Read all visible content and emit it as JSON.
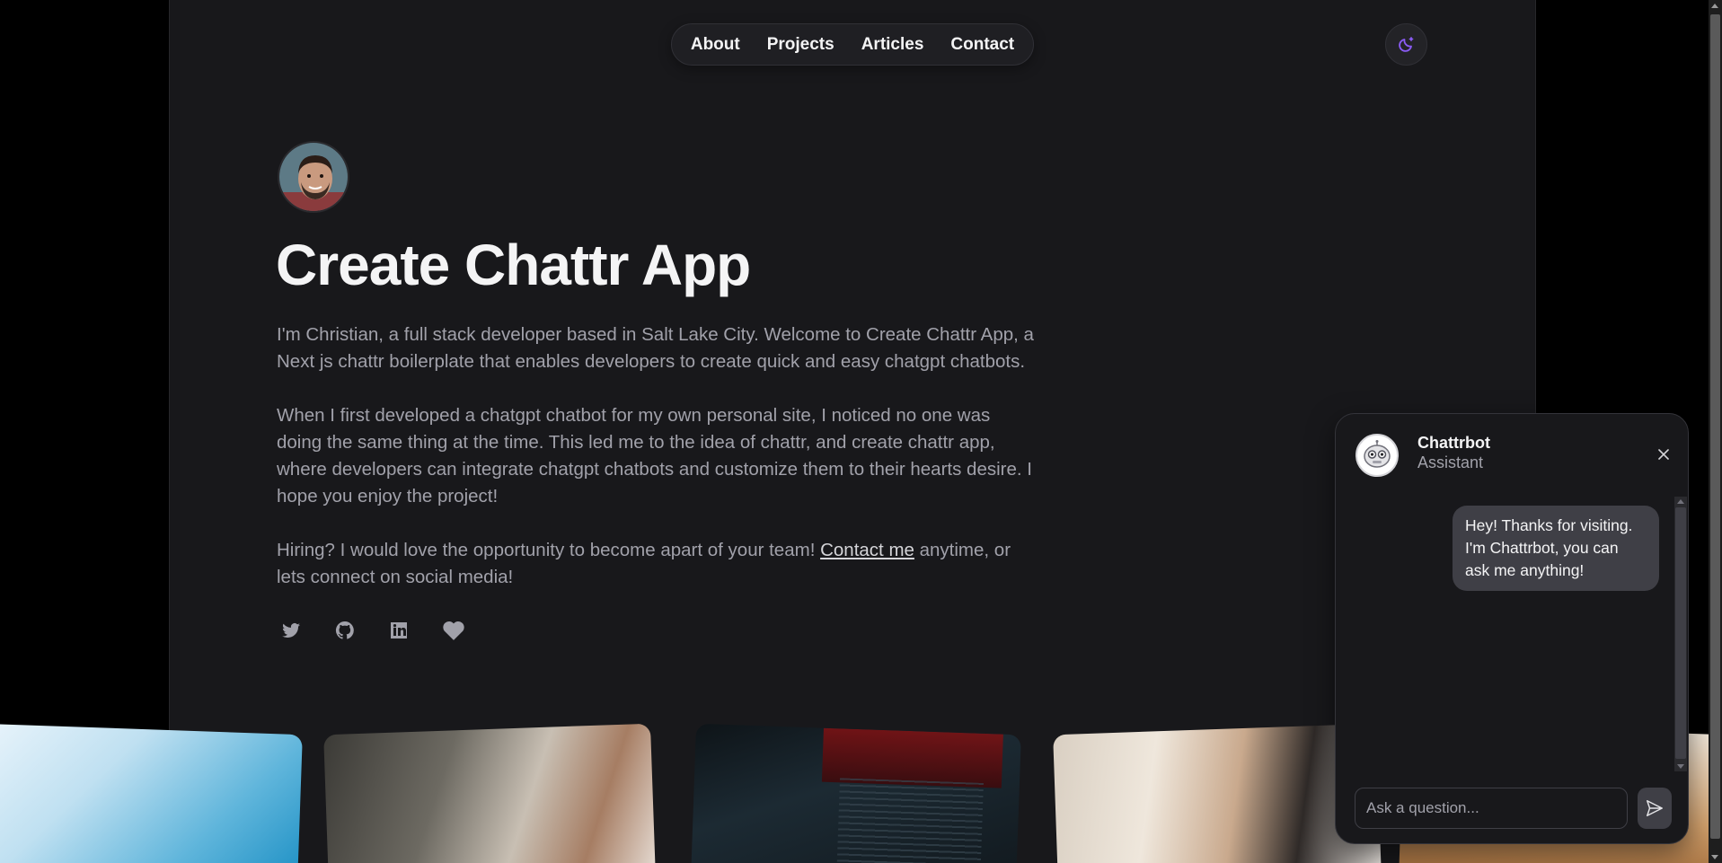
{
  "nav": {
    "links": [
      "About",
      "Projects",
      "Articles",
      "Contact"
    ]
  },
  "theme_toggle": {
    "icon": "moon-sparkle-icon",
    "accent": "#8b5cf6"
  },
  "hero": {
    "title": "Create Chattr App",
    "p1": "I'm Christian, a full stack developer based in Salt Lake City. Welcome to Create Chattr App, a Next js chattr boilerplate that enables developers to create quick and easy chatgpt chatbots.",
    "p2": "When I first developed a chatgpt chatbot for my own personal site, I noticed no one was doing the same thing at the time. This led me to the idea of chattr, and create chattr app, where developers can integrate chatgpt chatbots and customize them to their hearts desire. I hope you enjoy the project!",
    "p3_before": "Hiring? I would love the opportunity to become apart of your team! ",
    "p3_link": "Contact me",
    "p3_after": " anytime, or lets connect on social media!"
  },
  "socials": [
    "twitter-icon",
    "github-icon",
    "linkedin-icon",
    "heart-icon"
  ],
  "chat": {
    "bot_name": "Chattrbot",
    "bot_role": "Assistant",
    "message": "Hey! Thanks for visiting. I'm Chattrbot, you can ask me anything!",
    "input_placeholder": "Ask a question..."
  }
}
